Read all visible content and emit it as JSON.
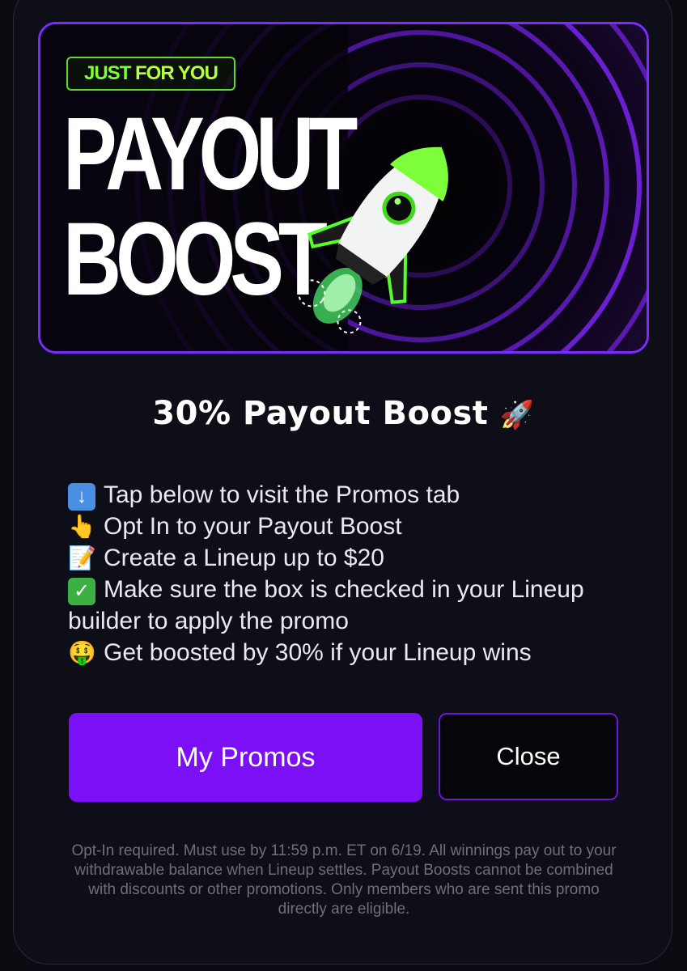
{
  "banner": {
    "tag_prefix": "JUST ",
    "tag_highlight": "FOR YOU",
    "headline_line1": "PAYOUT",
    "headline_line2": "BOOST"
  },
  "modal": {
    "title": "30% Payout Boost",
    "title_icon": "rocket-emoji",
    "steps": [
      {
        "icon": "down-arrow-emoji",
        "text": "Tap below to visit the Promos tab"
      },
      {
        "icon": "pointing-finger-emoji",
        "text": "Opt In to your Payout Boost"
      },
      {
        "icon": "memo-emoji",
        "text": "Create a Lineup up to $20"
      },
      {
        "icon": "check-mark-emoji",
        "text": "Make sure the box is checked in your Lineup",
        "continuation": "builder to apply the promo"
      },
      {
        "icon": "money-mouth-emoji",
        "text": "Get boosted by 30% if your Lineup wins"
      }
    ],
    "primary_button": "My Promos",
    "secondary_button": "Close",
    "disclaimer": "Opt-In required. Must use by 11:59 p.m. ET on 6/19. All winnings pay out to your withdrawable balance when Lineup settles. Payout Boosts cannot be combined with discounts or other promotions. Only members who are sent this promo directly are eligible."
  },
  "colors": {
    "accent": "#7b0ff5",
    "tag_green": "#7cff3a",
    "background": "#0d0e17"
  }
}
